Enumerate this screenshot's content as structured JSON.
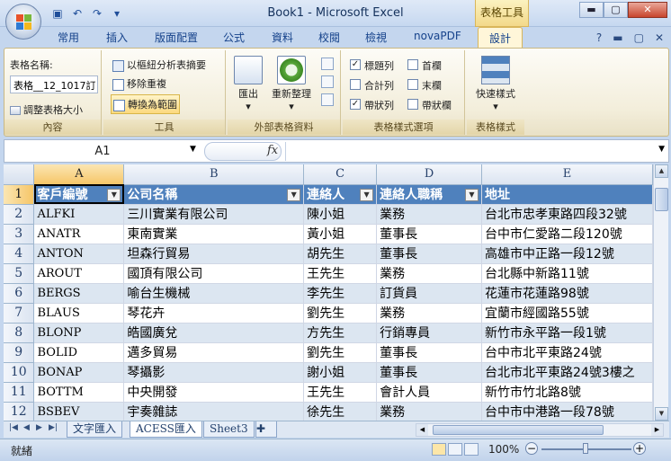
{
  "window": {
    "title": "Book1 - Microsoft Excel",
    "context_tab": "表格工具"
  },
  "ribbon_tabs": [
    "常用",
    "插入",
    "版面配置",
    "公式",
    "資料",
    "校閱",
    "檢視",
    "novaPDF",
    "設計"
  ],
  "ribbon": {
    "props": {
      "name_label": "表格名稱:",
      "name_value": "表格__12_1017訂",
      "resize": "調整表格大小",
      "group": "內容"
    },
    "tools": {
      "pivot": "以樞紐分析表摘要",
      "remove_dup": "移除重複",
      "convert": "轉換為範圍",
      "group": "工具"
    },
    "external": {
      "export": "匯出",
      "refresh": "重新整理",
      "group": "外部表格資料"
    },
    "options": {
      "header_row": "標題列",
      "first_col": "首欄",
      "total_row": "合計列",
      "last_col": "末欄",
      "banded_rows": "帶狀列",
      "banded_cols": "帶狀欄",
      "group": "表格樣式選項"
    },
    "styles": {
      "quick": "快速樣式",
      "group": "表格樣式"
    }
  },
  "formula_bar": {
    "name_box": "A1",
    "fx": "fx",
    "value": ""
  },
  "columns": [
    "A",
    "B",
    "C",
    "D",
    "E"
  ],
  "table_headers": [
    "客戶編號",
    "公司名稱",
    "連絡人",
    "連絡人職稱",
    "地址"
  ],
  "rows": [
    {
      "n": "2",
      "cells": [
        "ALFKI",
        "三川實業有限公司",
        "陳小姐",
        "業務",
        "台北市忠孝東路四段32號"
      ]
    },
    {
      "n": "3",
      "cells": [
        "ANATR",
        "東南實業",
        "黃小姐",
        "董事長",
        "台中市仁愛路二段120號"
      ]
    },
    {
      "n": "4",
      "cells": [
        "ANTON",
        "坦森行貿易",
        "胡先生",
        "董事長",
        "高雄市中正路一段12號"
      ]
    },
    {
      "n": "5",
      "cells": [
        "AROUT",
        "國頂有限公司",
        "王先生",
        "業務",
        "台北縣中新路11號"
      ]
    },
    {
      "n": "6",
      "cells": [
        "BERGS",
        "喻台生機械",
        "李先生",
        "訂貨員",
        "花蓮市花蓮路98號"
      ]
    },
    {
      "n": "7",
      "cells": [
        "BLAUS",
        "琴花卉",
        "劉先生",
        "業務",
        "宜蘭市經國路55號"
      ]
    },
    {
      "n": "8",
      "cells": [
        "BLONP",
        "皓國廣兌",
        "方先生",
        "行銷專員",
        "新竹市永平路一段1號"
      ]
    },
    {
      "n": "9",
      "cells": [
        "BOLID",
        "邁多貿易",
        "劉先生",
        "董事長",
        "台中市北平東路24號"
      ]
    },
    {
      "n": "10",
      "cells": [
        "BONAP",
        "琴攝影",
        "謝小姐",
        "董事長",
        "台北市北平東路24號3樓之"
      ]
    },
    {
      "n": "11",
      "cells": [
        "BOTTM",
        "中央開發",
        "王先生",
        "會計人員",
        "新竹市竹北路8號"
      ]
    },
    {
      "n": "12",
      "cells": [
        "BSBEV",
        "宇奏雜誌",
        "徐先生",
        "業務",
        "台中市中港路一段78號"
      ]
    }
  ],
  "sheets": [
    "文字匯入",
    "ACESS匯入",
    "Sheet3"
  ],
  "status": {
    "ready": "就緒",
    "zoom": "100%"
  }
}
